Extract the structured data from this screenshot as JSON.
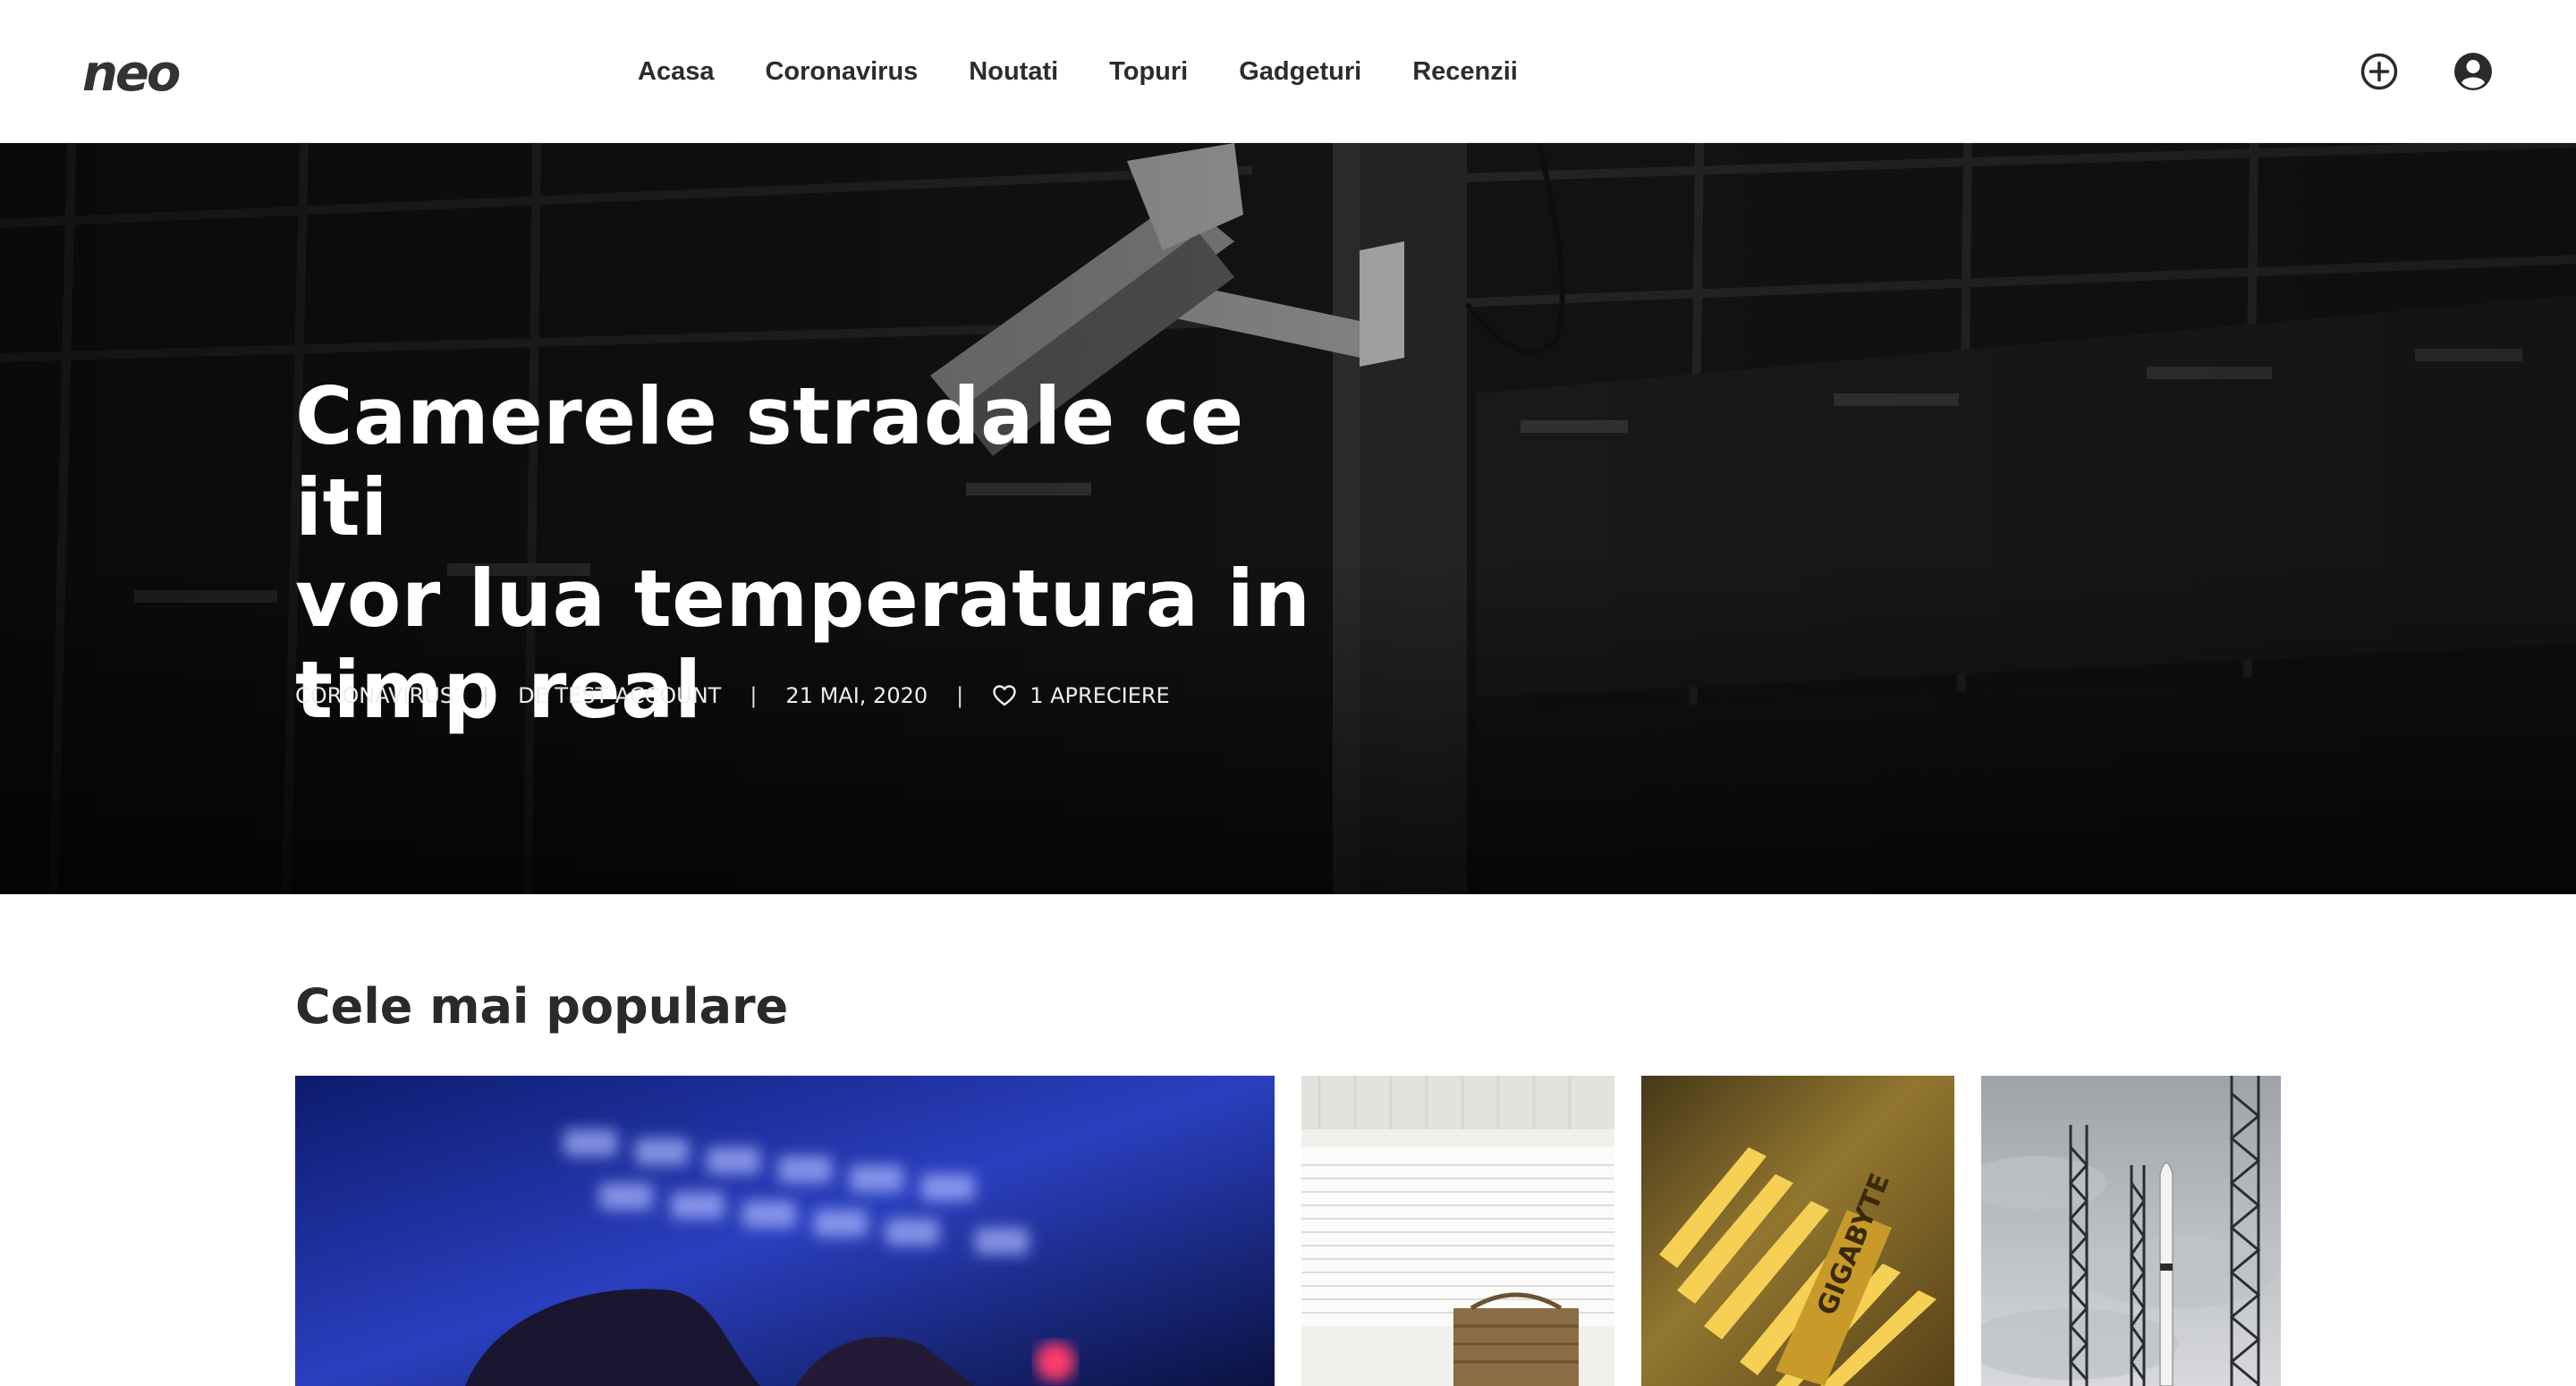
{
  "header": {
    "logo": "neo",
    "nav": [
      "Acasa",
      "Coronavirus",
      "Noutati",
      "Topuri",
      "Gadgeturi",
      "Recenzii"
    ],
    "icons": {
      "add": "plus-circle-icon",
      "account": "user-circle-icon"
    }
  },
  "hero": {
    "title_lines": [
      "Camerele stradale ce iti",
      "vor lua temperatura in",
      "timp real"
    ],
    "category": "CORONAVIRUS",
    "author": "DE TEST ACCOUNT",
    "date": "21 MAI, 2020",
    "likes": "1 APRECIERE",
    "separator": "|",
    "like_icon": "heart-outline-icon"
  },
  "popular": {
    "title": "Cele mai populare",
    "cards": [
      {
        "image": "keyboard-hands-photo"
      },
      {
        "image": "radiator-room-photo"
      },
      {
        "image": "gigabyte-chip-photo"
      },
      {
        "image": "rocket-launch-tower-photo"
      }
    ]
  }
}
